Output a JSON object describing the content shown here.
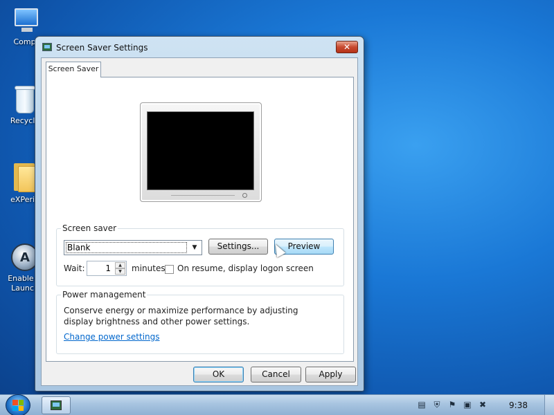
{
  "desktop": {
    "icons": [
      {
        "label": "Compu",
        "icon": "computer-icon"
      },
      {
        "label": "Recycle",
        "icon": "recycle-bin-icon"
      },
      {
        "label": "eXPerie",
        "icon": "folder-icon"
      },
      {
        "label": "Enable Q",
        "label2": "Launch",
        "icon": "quick-launch-icon"
      }
    ]
  },
  "window": {
    "title": "Screen Saver Settings",
    "close_glyph": "✕",
    "tab": "Screen Saver",
    "screen_saver": {
      "legend": "Screen saver",
      "selected": "Blank",
      "settings_button": "Settings...",
      "preview_button": "Preview",
      "wait_label": "Wait:",
      "wait_value": "1",
      "minutes_label": "minutes",
      "resume_checkbox_label": "On resume, display logon screen",
      "resume_checked": false
    },
    "power": {
      "legend": "Power management",
      "description": "Conserve energy or maximize performance by adjusting display brightness and other power settings.",
      "link": "Change power settings"
    },
    "buttons": {
      "ok": "OK",
      "cancel": "Cancel",
      "apply": "Apply"
    }
  },
  "taskbar": {
    "clock": "9:38",
    "tray_icons": [
      "document-icon",
      "security-shield-icon",
      "action-center-flag-icon",
      "network-icon",
      "volume-muted-icon"
    ]
  },
  "colors": {
    "desktop_background": "#1a78d6",
    "link": "#0066cc",
    "close_button": "#c84a30",
    "flag_red": "#f25022",
    "flag_green": "#7fba00",
    "flag_blue": "#00a4ef",
    "flag_yellow": "#ffb900"
  }
}
